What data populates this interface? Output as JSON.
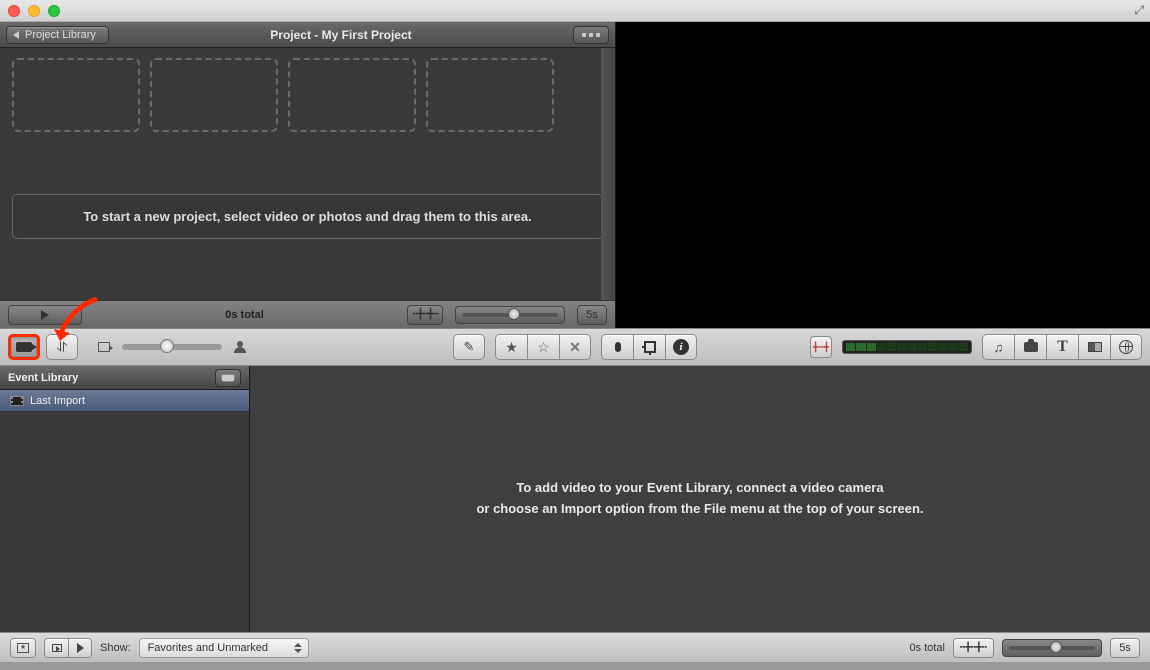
{
  "window": {
    "fullscreen_hint": "⤢"
  },
  "project": {
    "library_button": "Project Library",
    "title": "Project - My First Project",
    "hint": "To start a new project, select video or photos and drag them to this area.",
    "footer_total": "0s total",
    "zoom_label": "5s"
  },
  "events": {
    "header": "Event Library",
    "items": [
      "Last Import"
    ],
    "hint_line1": "To add video to your Event Library, connect a video camera",
    "hint_line2": "or choose an Import option from the File menu at the top of your screen."
  },
  "bottom": {
    "show_label": "Show:",
    "filter_value": "Favorites and Unmarked",
    "total": "0s total",
    "zoom_label": "5s"
  }
}
